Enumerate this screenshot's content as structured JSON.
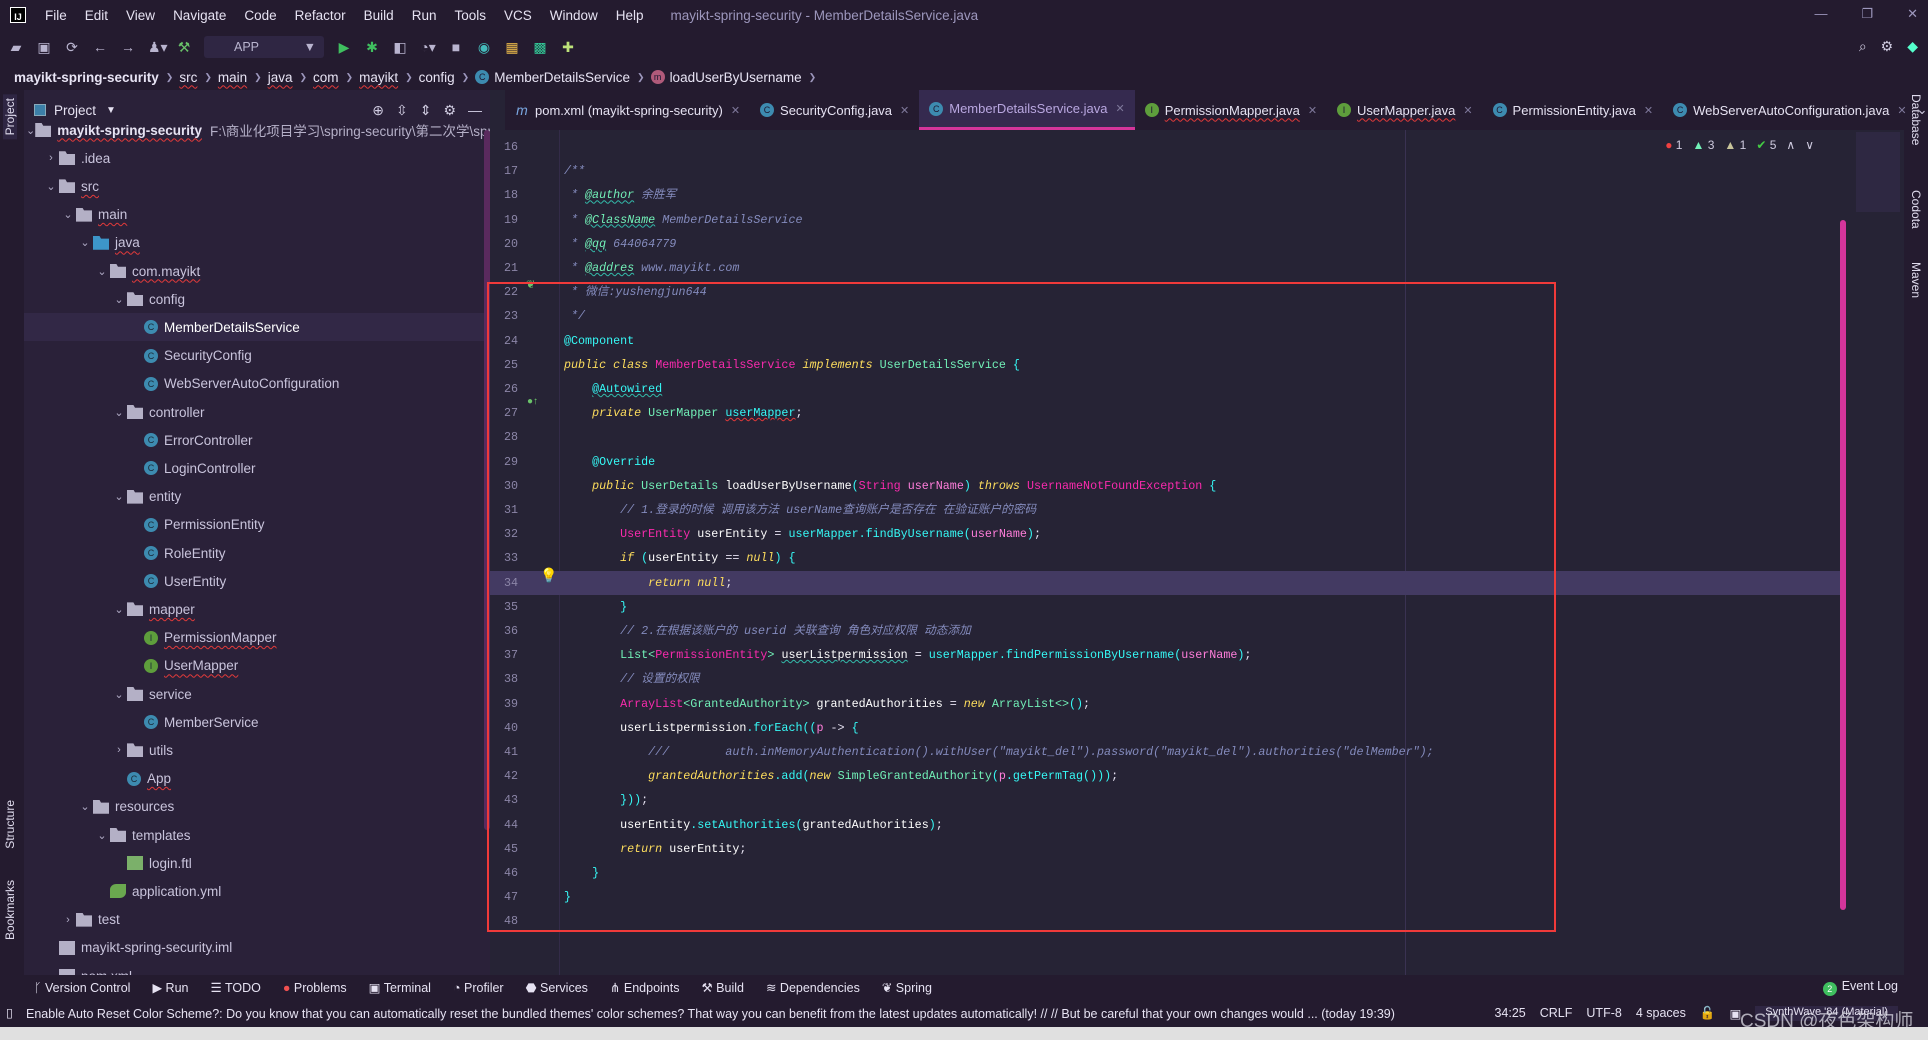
{
  "colors": {
    "background": "#262335",
    "panel": "#2a2139",
    "accent": "#d4359b",
    "highlight_line": "#433a62",
    "annotation_box": "#f03a3a"
  },
  "menubar": {
    "logo": "IJ",
    "items": [
      "File",
      "Edit",
      "View",
      "Navigate",
      "Code",
      "Refactor",
      "Build",
      "Run",
      "Tools",
      "VCS",
      "Window",
      "Help"
    ],
    "title": "mayikt-spring-security - MemberDetailsService.java"
  },
  "toolbar": {
    "run_config": "APP"
  },
  "breadcrumb": {
    "items": [
      "mayikt-spring-security",
      "src",
      "main",
      "java",
      "com",
      "mayikt",
      "config",
      "MemberDetailsService",
      "loadUserByUsername"
    ]
  },
  "side_labels": {
    "left": [
      "Project",
      "Structure",
      "Bookmarks"
    ],
    "right": [
      "Database",
      "Codota",
      "Maven"
    ]
  },
  "project": {
    "title": "Project",
    "root_path": "F:\\商业化项目学习\\spring-security\\第二次学\\spring-s",
    "tree": [
      {
        "label": "mayikt-spring-security",
        "depth": 0,
        "arrow": "down",
        "icon": "module",
        "bold": true,
        "wavy": true
      },
      {
        "label": ".idea",
        "depth": 1,
        "arrow": "right",
        "icon": "folder"
      },
      {
        "label": "src",
        "depth": 1,
        "arrow": "down",
        "icon": "folder",
        "wavy": true
      },
      {
        "label": "main",
        "depth": 2,
        "arrow": "down",
        "icon": "folder",
        "wavy": true
      },
      {
        "label": "java",
        "depth": 3,
        "arrow": "down",
        "icon": "folder-blue",
        "wavy": true
      },
      {
        "label": "com.mayikt",
        "depth": 4,
        "arrow": "down",
        "icon": "pkg",
        "wavy": true
      },
      {
        "label": "config",
        "depth": 5,
        "arrow": "down",
        "icon": "pkg"
      },
      {
        "label": "MemberDetailsService",
        "depth": 6,
        "icon": "class",
        "selected": true
      },
      {
        "label": "SecurityConfig",
        "depth": 6,
        "icon": "class"
      },
      {
        "label": "WebServerAutoConfiguration",
        "depth": 6,
        "icon": "class"
      },
      {
        "label": "controller",
        "depth": 5,
        "arrow": "down",
        "icon": "pkg"
      },
      {
        "label": "ErrorController",
        "depth": 6,
        "icon": "class"
      },
      {
        "label": "LoginController",
        "depth": 6,
        "icon": "class"
      },
      {
        "label": "entity",
        "depth": 5,
        "arrow": "down",
        "icon": "pkg"
      },
      {
        "label": "PermissionEntity",
        "depth": 6,
        "icon": "class"
      },
      {
        "label": "RoleEntity",
        "depth": 6,
        "icon": "class"
      },
      {
        "label": "UserEntity",
        "depth": 6,
        "icon": "class"
      },
      {
        "label": "mapper",
        "depth": 5,
        "arrow": "down",
        "icon": "pkg",
        "wavy": true
      },
      {
        "label": "PermissionMapper",
        "depth": 6,
        "icon": "interface",
        "wavy": true
      },
      {
        "label": "UserMapper",
        "depth": 6,
        "icon": "interface",
        "wavy": true
      },
      {
        "label": "service",
        "depth": 5,
        "arrow": "down",
        "icon": "pkg"
      },
      {
        "label": "MemberService",
        "depth": 6,
        "icon": "class"
      },
      {
        "label": "utils",
        "depth": 5,
        "arrow": "right",
        "icon": "pkg"
      },
      {
        "label": "App",
        "depth": 5,
        "icon": "app",
        "wavy": true
      },
      {
        "label": "resources",
        "depth": 3,
        "arrow": "down",
        "icon": "folder"
      },
      {
        "label": "templates",
        "depth": 4,
        "arrow": "down",
        "icon": "folder"
      },
      {
        "label": "login.ftl",
        "depth": 5,
        "icon": "ftl"
      },
      {
        "label": "application.yml",
        "depth": 4,
        "icon": "yml"
      },
      {
        "label": "test",
        "depth": 2,
        "arrow": "right",
        "icon": "folder"
      },
      {
        "label": "mayikt-spring-security.iml",
        "depth": 1,
        "icon": "file"
      },
      {
        "label": "pom.xml",
        "depth": 1,
        "icon": "file"
      }
    ]
  },
  "tabs": [
    {
      "label": "pom.xml (mayikt-spring-security)",
      "icon": "maven-icon",
      "glyph": "m",
      "color": "#7aa7e0"
    },
    {
      "label": "SecurityConfig.java",
      "icon": "class-icon",
      "glyph": "C",
      "color": "#3d8bb0"
    },
    {
      "label": "MemberDetailsService.java",
      "icon": "class-icon",
      "glyph": "C",
      "color": "#3d8bb0",
      "active": true
    },
    {
      "label": "PermissionMapper.java",
      "icon": "interface-icon",
      "glyph": "I",
      "color": "#5e9e3c",
      "wavy": true
    },
    {
      "label": "UserMapper.java",
      "icon": "interface-icon",
      "glyph": "I",
      "color": "#5e9e3c",
      "wavy": true
    },
    {
      "label": "PermissionEntity.java",
      "icon": "class-icon",
      "glyph": "C",
      "color": "#3d8bb0"
    },
    {
      "label": "WebServerAutoConfiguration.java",
      "icon": "class-icon",
      "glyph": "C",
      "color": "#3d8bb0"
    }
  ],
  "inspections": {
    "errors": "1",
    "warnings": "3",
    "weak_warnings": "1",
    "ok": "5"
  },
  "editor": {
    "first_line": 16,
    "current_line": 34,
    "lines": [
      [],
      [
        [
          "cm",
          "/**"
        ]
      ],
      [
        [
          "cm",
          " * "
        ],
        [
          "doc",
          "@author"
        ],
        [
          "cm",
          " 余胜军"
        ]
      ],
      [
        [
          "cm",
          " * "
        ],
        [
          "doc",
          "@ClassName"
        ],
        [
          "cm",
          " MemberDetailsService"
        ]
      ],
      [
        [
          "cm",
          " * "
        ],
        [
          "doc",
          "@qq"
        ],
        [
          "cm",
          " 644064779"
        ]
      ],
      [
        [
          "cm",
          " * "
        ],
        [
          "doc",
          "@addres"
        ],
        [
          "cm",
          " www.mayikt.com"
        ]
      ],
      [
        [
          "cm",
          " * 微信:yushengjun644"
        ]
      ],
      [
        [
          "cm",
          " */"
        ]
      ],
      [
        [
          "ann",
          "@Component"
        ]
      ],
      [
        [
          "kw",
          "public class "
        ],
        [
          "cls",
          "MemberDetailsService"
        ],
        [
          "kw",
          " implements "
        ],
        [
          "type",
          "UserDetailsService"
        ],
        [
          "ann",
          " {"
        ]
      ],
      [
        [
          "pl",
          "    "
        ],
        [
          "ann2",
          "@Autowired"
        ]
      ],
      [
        [
          "pl",
          "    "
        ],
        [
          "kw",
          "private "
        ],
        [
          "type",
          "UserMapper "
        ],
        [
          "err",
          "userMapper"
        ],
        [
          "pl",
          ";"
        ]
      ],
      [],
      [
        [
          "pl",
          "    "
        ],
        [
          "ann",
          "@Override"
        ]
      ],
      [
        [
          "pl",
          "    "
        ],
        [
          "kw",
          "public "
        ],
        [
          "type",
          "UserDetails "
        ],
        [
          "id",
          "loadUserByUsername"
        ],
        [
          "ann",
          "("
        ],
        [
          "cls",
          "String "
        ],
        [
          "fld",
          "userName"
        ],
        [
          "ann",
          ")"
        ],
        [
          "kw",
          " throws "
        ],
        [
          "cls",
          "UsernameNotFoundException"
        ],
        [
          "ann",
          " {"
        ]
      ],
      [
        [
          "pl",
          "        "
        ],
        [
          "cm",
          "// 1.登录的时候 调用该方法 userName查询账户是否存在 在验证账户的密码"
        ]
      ],
      [
        [
          "pl",
          "        "
        ],
        [
          "cls",
          "UserEntity "
        ],
        [
          "id",
          "userEntity "
        ],
        [
          "pl",
          "= "
        ],
        [
          "fn",
          "userMapper.findByUsername("
        ],
        [
          "fld",
          "userName"
        ],
        [
          "fn",
          ")"
        ],
        [
          "pl",
          ";"
        ]
      ],
      [
        [
          "pl",
          "        "
        ],
        [
          "kw",
          "if "
        ],
        [
          "ann",
          "("
        ],
        [
          "id",
          "userEntity "
        ],
        [
          "pl",
          "== "
        ],
        [
          "kw",
          "null"
        ],
        [
          "ann",
          ") {"
        ]
      ],
      [
        [
          "pl",
          "            "
        ],
        [
          "kw",
          "return null"
        ],
        [
          "pl",
          ";"
        ]
      ],
      [
        [
          "pl",
          "        "
        ],
        [
          "ann",
          "}"
        ]
      ],
      [
        [
          "pl",
          "        "
        ],
        [
          "cm",
          "// 2.在根据该账户的 userid 关联查询 角色对应权限 动态添加"
        ]
      ],
      [
        [
          "pl",
          "        "
        ],
        [
          "type",
          "List<"
        ],
        [
          "cls",
          "PermissionEntity"
        ],
        [
          "type",
          "> "
        ],
        [
          "fldu",
          "userListpermission"
        ],
        [
          "pl",
          " = "
        ],
        [
          "fn",
          "userMapper.findPermissionByUsername("
        ],
        [
          "fld",
          "userName"
        ],
        [
          "fn",
          ")"
        ],
        [
          "pl",
          ";"
        ]
      ],
      [
        [
          "pl",
          "        "
        ],
        [
          "cm",
          "// 设置的权限"
        ]
      ],
      [
        [
          "pl",
          "        "
        ],
        [
          "cls",
          "ArrayList"
        ],
        [
          "type",
          "<GrantedAuthority> "
        ],
        [
          "id",
          "grantedAuthorities "
        ],
        [
          "pl",
          "= "
        ],
        [
          "kw",
          "new "
        ],
        [
          "type",
          "ArrayList<>"
        ],
        [
          "ann",
          "()"
        ],
        [
          "pl",
          ";"
        ]
      ],
      [
        [
          "pl",
          "        "
        ],
        [
          "id",
          "userListpermission"
        ],
        [
          "fn",
          ".forEach(("
        ],
        [
          "fld",
          "p"
        ],
        [
          "pl",
          " -> "
        ],
        [
          "ann",
          "{"
        ]
      ],
      [
        [
          "pl",
          "            "
        ],
        [
          "cm",
          "///        auth.inMemoryAuthentication().withUser(\"mayikt_del\").password(\"mayikt_del\").authorities(\"delMember\");"
        ]
      ],
      [
        [
          "pl",
          "            "
        ],
        [
          "kw",
          "grantedAuthorities"
        ],
        [
          "fn",
          ".add("
        ],
        [
          "kw",
          "new "
        ],
        [
          "type",
          "SimpleGrantedAuthority"
        ],
        [
          "ann",
          "("
        ],
        [
          "fld",
          "p"
        ],
        [
          "fn",
          ".getPermTag()))"
        ],
        [
          "pl",
          ";"
        ]
      ],
      [
        [
          "pl",
          "        "
        ],
        [
          "ann",
          "}))"
        ],
        [
          "pl",
          ";"
        ]
      ],
      [
        [
          "pl",
          "        "
        ],
        [
          "id",
          "userEntity"
        ],
        [
          "fn",
          ".setAuthorities("
        ],
        [
          "id",
          "grantedAuthorities"
        ],
        [
          "fn",
          ")"
        ],
        [
          "pl",
          ";"
        ]
      ],
      [
        [
          "pl",
          "        "
        ],
        [
          "kw",
          "return "
        ],
        [
          "id",
          "userEntity"
        ],
        [
          "pl",
          ";"
        ]
      ],
      [
        [
          "pl",
          "    "
        ],
        [
          "ann",
          "}"
        ]
      ],
      [
        [
          "ann",
          "}"
        ]
      ],
      []
    ]
  },
  "bottom_tools": [
    {
      "label": "Version Control",
      "icon": "branch-icon",
      "glyph": "ᚴ"
    },
    {
      "label": "Run",
      "icon": "run-icon",
      "glyph": "▶"
    },
    {
      "label": "TODO",
      "icon": "list-icon",
      "glyph": "☰"
    },
    {
      "label": "Problems",
      "icon": "problems-icon",
      "glyph": "●"
    },
    {
      "label": "Terminal",
      "icon": "terminal-icon",
      "glyph": "▣"
    },
    {
      "label": "Profiler",
      "icon": "profiler-icon",
      "glyph": "◔"
    },
    {
      "label": "Services",
      "icon": "services-icon",
      "glyph": "⬣"
    },
    {
      "label": "Endpoints",
      "icon": "endpoints-icon",
      "glyph": "⋔"
    },
    {
      "label": "Build",
      "icon": "hammer-icon",
      "glyph": "⚒"
    },
    {
      "label": "Dependencies",
      "icon": "dependencies-icon",
      "glyph": "≋"
    },
    {
      "label": "Spring",
      "icon": "spring-icon",
      "glyph": "❦"
    }
  ],
  "event_log": {
    "count": "2",
    "label": "Event Log"
  },
  "status": {
    "message": "Enable Auto Reset Color Scheme?: Do you know that you can automatically reset the bundled themes' color schemes? That way you can benefit from the latest updates automatically! // // But be careful that your own changes would ... (today 19:39)",
    "position": "34:25",
    "line_sep": "CRLF",
    "encoding": "UTF-8",
    "indent": "4 spaces",
    "theme": "SynthWave '84 (Material)"
  },
  "watermark": "CSDN @夜色架构师"
}
